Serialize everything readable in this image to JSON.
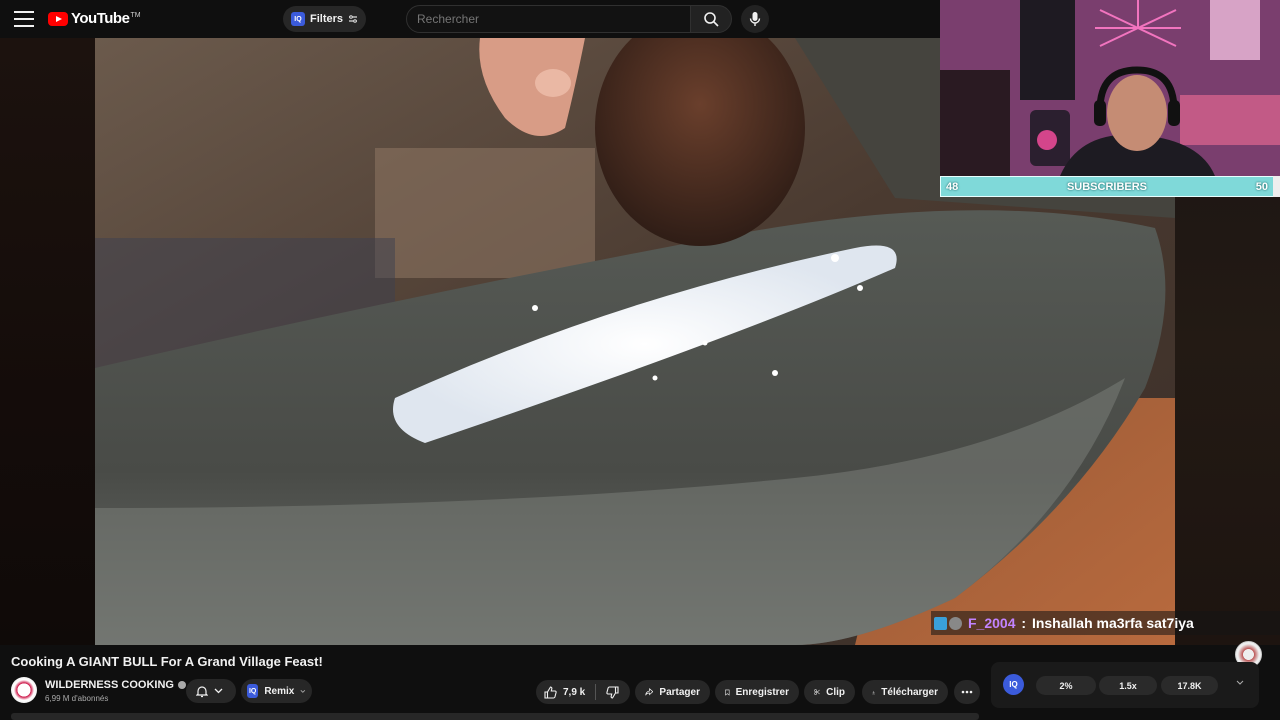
{
  "header": {
    "logo_text": "YouTube",
    "logo_tm": "TM",
    "filters_label": "Filters",
    "search_placeholder": "Rechercher"
  },
  "stream_overlay": {
    "subs_current": "48",
    "subs_label": "SUBSCRIBERS",
    "subs_goal": "50",
    "chat_user": "F_2004",
    "chat_separator": " : ",
    "chat_message": "Inshallah ma3rfa sat7iya"
  },
  "video": {
    "title": "Cooking A GIANT BULL For A Grand Village Feast!",
    "channel_name": "WILDERNESS COOKING",
    "subscribers": "6,99 M d'abonnés"
  },
  "actions": {
    "remix_label": "Remix",
    "like_count": "7,9 k",
    "share_label": "Partager",
    "save_label": "Enregistrer",
    "clip_label": "Clip",
    "download_label": "Télécharger"
  },
  "stats": {
    "iq_label": "IQ",
    "chip_1": "2%",
    "chip_2": "1.5x",
    "chip_3": "17.8K"
  },
  "colors": {
    "brand_red": "#ff0000",
    "subs_bar": "#7fd9d9",
    "chat_user": "#c283ff",
    "iq_blue": "#3b5bdb"
  },
  "icons": [
    "menu-icon",
    "youtube-logo-icon",
    "sliders-icon",
    "search-icon",
    "mic-icon",
    "bell-icon",
    "chevron-down-icon",
    "thumbs-up-icon",
    "thumbs-down-icon",
    "share-icon",
    "bookmark-icon",
    "scissors-icon",
    "download-icon",
    "more-icon"
  ]
}
